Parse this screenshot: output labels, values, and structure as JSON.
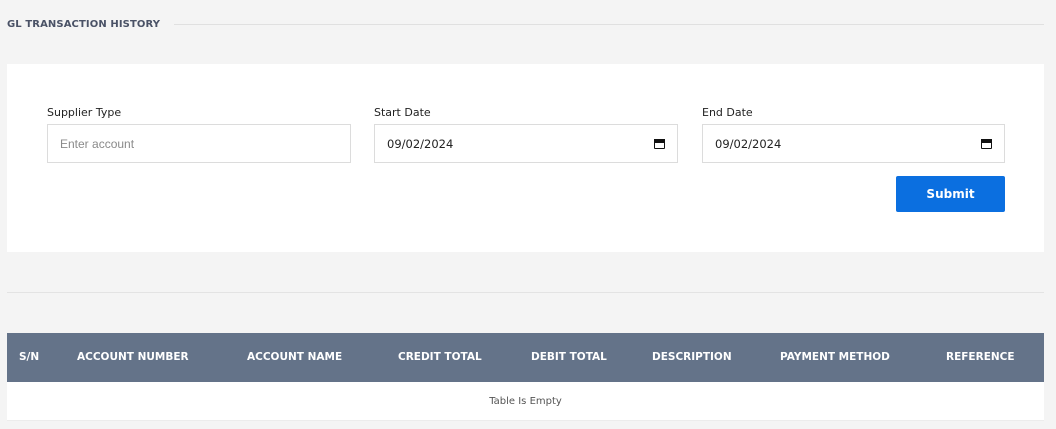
{
  "page": {
    "title": "GL TRANSACTION HISTORY"
  },
  "filters": {
    "supplier_type": {
      "label": "Supplier Type",
      "placeholder": "Enter account",
      "value": ""
    },
    "start_date": {
      "label": "Start Date",
      "value": "09/02/2024"
    },
    "end_date": {
      "label": "End Date",
      "value": "09/02/2024"
    },
    "submit_label": "Submit"
  },
  "table": {
    "columns": [
      "S/N",
      "ACCOUNT NUMBER",
      "ACCOUNT NAME",
      "CREDIT TOTAL",
      "DEBIT TOTAL",
      "DESCRIPTION",
      "PAYMENT METHOD",
      "REFERENCE"
    ],
    "rows": [],
    "empty_text": "Table Is Empty"
  },
  "colors": {
    "accent": "#0b6fe0",
    "table_header": "#647389"
  },
  "icons": {
    "date_picker": "calendar-icon"
  }
}
